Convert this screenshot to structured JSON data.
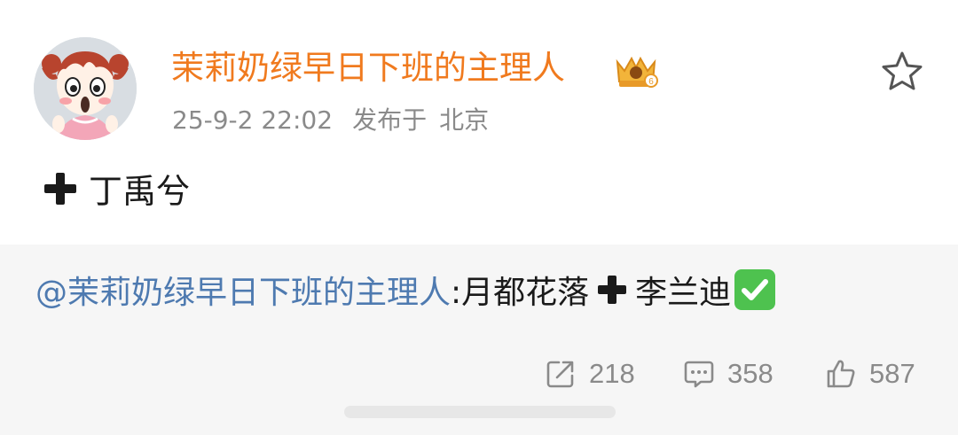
{
  "post": {
    "author": "茉莉奶绿早日下班的主理人",
    "badge_icon": "crown-badge-icon",
    "timestamp": "25-9-2 22:02",
    "published_label": "发布于",
    "location": "北京",
    "text": "丁禹兮",
    "favorite_icon": "star-icon"
  },
  "retweet": {
    "author": "@茉莉奶绿早日下班的主理人",
    "colon": ":",
    "text_before": "月都花落",
    "text_after": "李兰迪",
    "emoji": "check-mark-button-emoji"
  },
  "actions": {
    "repost_count": "218",
    "comment_count": "358",
    "like_count": "587"
  },
  "colors": {
    "author_orange": "#f07a1e",
    "link_blue": "#4e7ab0",
    "meta_gray": "#8a8a8a",
    "retweet_bg": "#f6f6f6"
  }
}
